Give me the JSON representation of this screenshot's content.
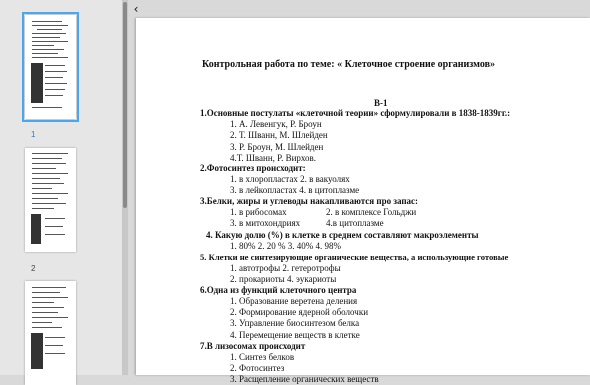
{
  "thumbnails": [
    {
      "number": "1",
      "selected": true
    },
    {
      "number": "2",
      "selected": false
    },
    {
      "number": "3",
      "selected": false
    }
  ],
  "toolbar": {
    "collapse_icon": "‹"
  },
  "document": {
    "title": "Контрольная работа по теме: « Клеточное строение организмов»",
    "variant": "В-1",
    "lines": [
      "1.Основные постулаты «клеточной теории» сформулировали в 1838-1839гг.:",
      "1. А. Левенгук, Р. Броун",
      "2. Т. Шванн, М. Шлейден",
      "3. Р. Броун, М. Шлейден",
      "4.Т. Шванн, Р. Вирхов.",
      "2.Фотосинтез происходит:",
      "1. в хлоропластах   2. в вакуолях",
      "3. в лейкопластах    4. в цитоплазме",
      "3.Белки, жиры и углеводы накапливаются про запас:",
      "1. в рибосомах",
      "2. в комплексе Гольджи",
      "3. в митохондриях",
      "4.в цитоплазме",
      "4. Какую долю (%) в клетке в среднем составляют макроэлементы",
      "1. 80%  2. 20 %   3. 40%   4. 98%",
      "5. Клетки не синтезирующие органические вещества, а использующие готовые",
      "1. автотрофы      2. гетеротрофы",
      "2. прокариоты    4. эукариоты",
      "6.Одна из функций клеточного центра",
      "1.    Образование веретена деления",
      "2.    Формирование ядерной оболочки",
      "3.    Управление биосинтезом белка",
      "4.    Перемещение веществ в клетке",
      "7.В лизосомах происходит",
      "1.    Синтез белков",
      "2.    Фотосинтез",
      "3.    Расщепление органических веществ"
    ]
  }
}
